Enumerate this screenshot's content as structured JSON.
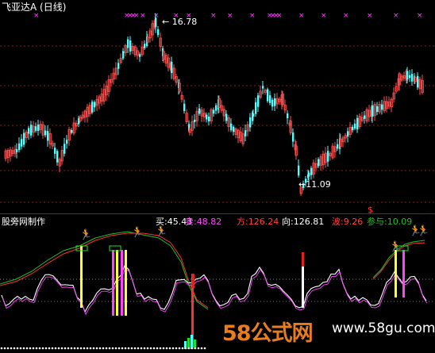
{
  "main_panel": {
    "title": "飞亚达A (日线)",
    "high_label": "16.78",
    "low_label": "11.09",
    "marker_char": "$"
  },
  "indicator_panel": {
    "title": "股旁网制作",
    "readouts": [
      {
        "label": "买",
        "value": "45.43",
        "color": "#ffffff"
      },
      {
        "label": "卖",
        "value": "48.82",
        "color": "#ff44ff"
      },
      {
        "label": "方",
        "value": "126.24",
        "color": "#ff4040"
      },
      {
        "label": "向",
        "value": "126.81",
        "color": "#ffffff"
      },
      {
        "label": "波",
        "value": "9.26",
        "color": "#ff4040"
      },
      {
        "label": "参与",
        "value": "10.09",
        "color": "#20c020"
      }
    ]
  },
  "watermark": {
    "logo": "58公式网",
    "url": "www.58gu.com"
  },
  "chart_data": {
    "type": "candlestick",
    "title": "飞亚达A (日线)",
    "annotated_high": 16.78,
    "annotated_low": 11.09,
    "up_color": "#ff5050",
    "down_color": "#54ffff"
  },
  "colors": {
    "background": "#000000",
    "grid": "#8b1a1a",
    "up": "#ff5050",
    "down": "#54ffff",
    "magenta": "#ff44ff",
    "yellow": "#ffff33",
    "green_line": "#20c020",
    "red_line": "#ff3030"
  }
}
